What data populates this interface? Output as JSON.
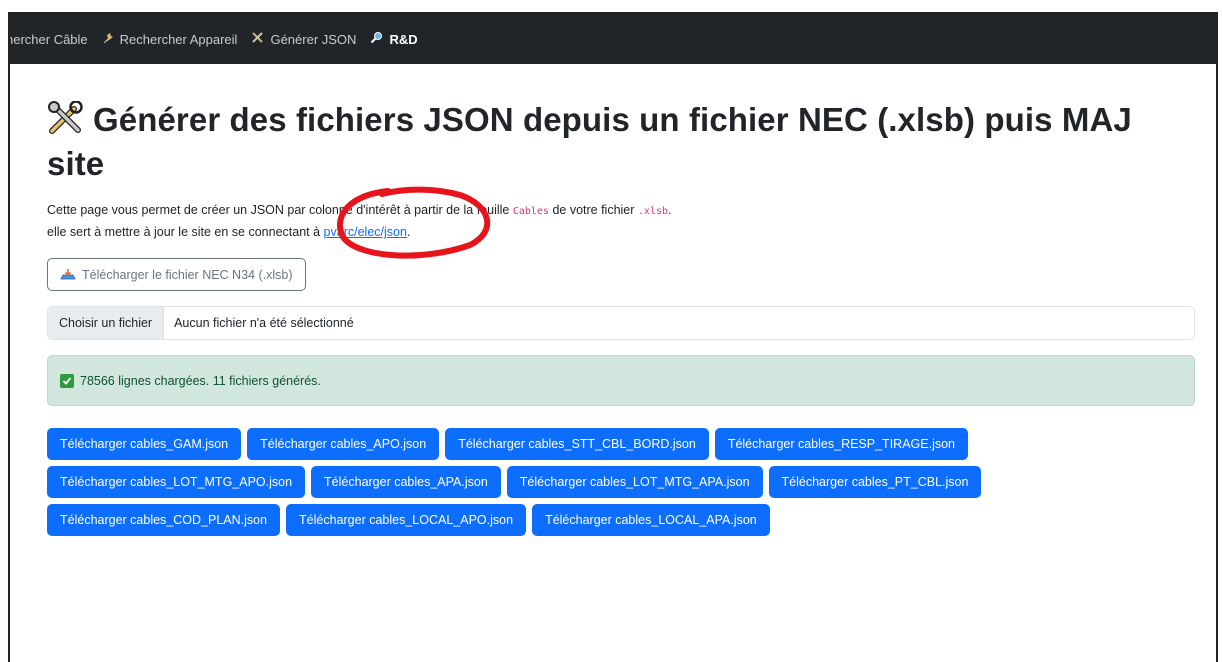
{
  "navbar": {
    "items": [
      {
        "label": "hercher Câble",
        "icon": "",
        "active": false
      },
      {
        "label": "Rechercher Appareil",
        "icon": "plug-icon",
        "active": false
      },
      {
        "label": "Générer JSON",
        "icon": "tools-icon",
        "active": false
      },
      {
        "label": "R&D",
        "icon": "magnifier-icon",
        "active": true
      }
    ]
  },
  "page": {
    "title": "Générer des fichiers JSON depuis un fichier NEC (.xlsb) puis MAJ site",
    "desc_line1_part1": "Cette page vous permet de créer un JSON par colonne d'intérêt à partir de la feuille ",
    "desc_line1_code1": "Cables",
    "desc_line1_part2": " de votre fichier ",
    "desc_line1_code2": ".xlsb",
    "desc_line1_part3": ".",
    "desc_line2_part1": "elle sert à mettre à jour le site en se connectant à ",
    "desc_line2_link": "pvarc/elec/json",
    "desc_line2_part2": ".",
    "download_template_label": "Télécharger le fichier NEC N34 (.xlsb)"
  },
  "file_input": {
    "button_label": "Choisir un fichier",
    "status": "Aucun fichier n'a été sélectionné"
  },
  "alert": {
    "text": "78566 lignes chargées. 11 fichiers générés.",
    "icon": "check-box-icon"
  },
  "downloads": {
    "rows": [
      [
        "Télécharger cables_GAM.json",
        "Télécharger cables_APO.json",
        "Télécharger cables_STT_CBL_BORD.json",
        "Télécharger cables_RESP_TIRAGE.json"
      ],
      [
        "Télécharger cables_LOT_MTG_APO.json",
        "Télécharger cables_APA.json",
        "Télécharger cables_LOT_MTG_APA.json",
        "Télécharger cables_PT_CBL.json"
      ],
      [
        "Télécharger cables_COD_PLAN.json",
        "Télécharger cables_LOCAL_APO.json",
        "Télécharger cables_LOCAL_APA.json"
      ]
    ]
  },
  "colors": {
    "navbar_bg": "#212529",
    "primary": "#0d6efd",
    "alert_bg": "#d1e7dd",
    "annotation": "#e8141c"
  }
}
